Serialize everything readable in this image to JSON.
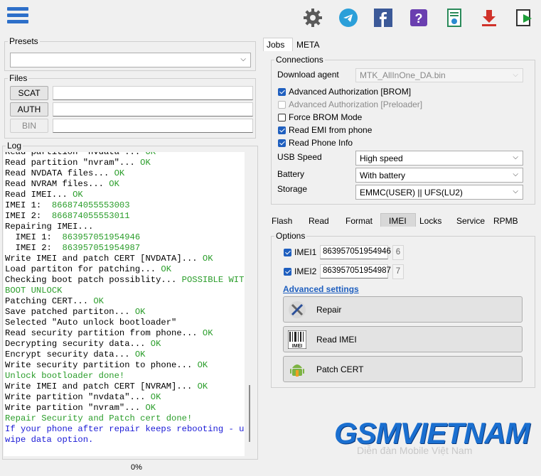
{
  "toolbar": {
    "icons": [
      "menu-icon",
      "gear-icon",
      "telegram-icon",
      "facebook-icon",
      "help-icon",
      "notes-icon",
      "download-icon",
      "exit-icon"
    ]
  },
  "presets": {
    "label": "Presets",
    "value": ""
  },
  "files": {
    "label": "Files",
    "buttons": [
      {
        "label": "SCAT"
      },
      {
        "label": "AUTH"
      },
      {
        "label": "BIN"
      }
    ]
  },
  "log": {
    "label": "Log",
    "lines": [
      {
        "t": "Read partition \"nvdata\"... ",
        "ok": "OK"
      },
      {
        "t": "Read partition \"nvram\"... ",
        "ok": "OK"
      },
      {
        "t": "Read NVDATA files... ",
        "ok": "OK"
      },
      {
        "t": "Read NVRAM files... ",
        "ok": "OK"
      },
      {
        "t": "Read IMEI... ",
        "ok": "OK"
      },
      {
        "t": "IMEI 1:  ",
        "ok": "866874055553003"
      },
      {
        "t": "IMEI 2:  ",
        "ok": "866874055553011"
      },
      {
        "t": "Repairing IMEI...",
        "ok": ""
      },
      {
        "t": "  IMEI 1:  ",
        "ok": "863957051954946"
      },
      {
        "t": "  IMEI 2:  ",
        "ok": "863957051954987"
      },
      {
        "t": "Write IMEI and patch CERT [NVDATA]... ",
        "ok": "OK"
      },
      {
        "t": "Load partiton for patching... ",
        "ok": "OK"
      },
      {
        "t": "Checking boot patch possiblity... ",
        "ok": "POSSIBLE WITH"
      },
      {
        "t": "",
        "ok": "BOOT UNLOCK"
      },
      {
        "t": "Patching CERT... ",
        "ok": "OK"
      },
      {
        "t": "Save patched partiton... ",
        "ok": "OK"
      },
      {
        "t": "Selected \"Auto unlock bootloader\"",
        "ok": ""
      },
      {
        "t": "Read security partition from phone... ",
        "ok": "OK"
      },
      {
        "t": "Decrypting security data... ",
        "ok": "OK"
      },
      {
        "t": "Encrypt security data... ",
        "ok": "OK"
      },
      {
        "t": "Write security partition to phone... ",
        "ok": "OK"
      },
      {
        "t": "",
        "ok": "Unlock bootloader done!"
      },
      {
        "t": "Write IMEI and patch CERT [NVRAM]... ",
        "ok": "OK"
      },
      {
        "t": "Write partition \"nvdata\"... ",
        "ok": "OK"
      },
      {
        "t": "Write partition \"nvram\"... ",
        "ok": "OK"
      },
      {
        "t": "",
        "ok": "Repair Security and Patch cert done!"
      },
      {
        "t": "",
        "blue": "If your phone after repair keeps rebooting - use"
      },
      {
        "t": "",
        "blue": "wipe data option."
      }
    ]
  },
  "progress": {
    "text": "0%",
    "value": 0
  },
  "top_tabs": [
    {
      "label": "Jobs"
    },
    {
      "label": "META"
    }
  ],
  "connections": {
    "label": "Connections",
    "download_agent_label": "Download agent",
    "download_agent_value": "MTK_AllInOne_DA.bin",
    "checks": [
      {
        "label": "Advanced Authorization [BROM]",
        "state": "on"
      },
      {
        "label": "Advanced Authorization [Preloader]",
        "state": "dis"
      },
      {
        "label": "Force BROM Mode",
        "state": "off"
      },
      {
        "label": "Read EMI from phone",
        "state": "on"
      },
      {
        "label": "Read Phone Info",
        "state": "on"
      }
    ],
    "usb_speed_label": "USB Speed",
    "usb_speed_value": "High speed",
    "battery_label": "Battery",
    "battery_value": "With battery",
    "storage_label": "Storage",
    "storage_value": "EMMC(USER) || UFS(LU2)"
  },
  "sub_tabs": [
    {
      "label": "Flash"
    },
    {
      "label": "Read"
    },
    {
      "label": "Format"
    },
    {
      "label": "IMEI"
    },
    {
      "label": "Locks"
    },
    {
      "label": "Service"
    },
    {
      "label": "RPMB"
    }
  ],
  "options": {
    "label": "Options",
    "imei1_label": "IMEI1",
    "imei1_value": "863957051954946",
    "imei1_digit": "6",
    "imei2_label": "IMEI2",
    "imei2_value": "863957051954987",
    "imei2_digit": "7",
    "advanced": "Advanced settings",
    "buttons": [
      {
        "label": "Repair"
      },
      {
        "label": "Read IMEI"
      },
      {
        "label": "Patch CERT"
      }
    ]
  },
  "watermark": {
    "title": "GSMVIETNAM",
    "subtitle": "Diễn đàn Mobile Việt Nam"
  },
  "colors": {
    "accent": "#1f5fbf",
    "ok": "#2a9d2a",
    "info": "#1a1ad6"
  }
}
